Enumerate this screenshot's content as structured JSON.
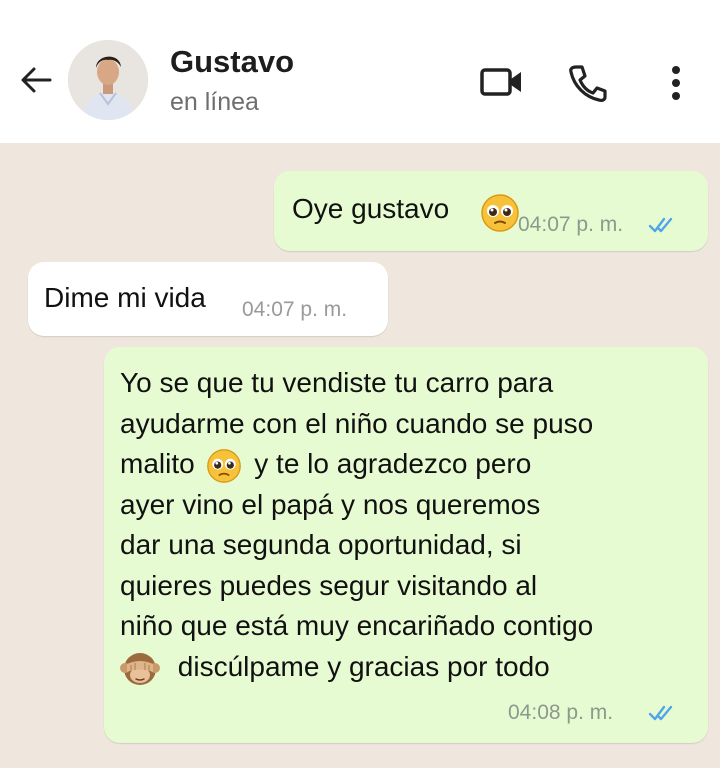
{
  "header": {
    "contact_name": "Gustavo",
    "status": "en línea"
  },
  "icons": {
    "back": "arrow-left-icon",
    "video": "video-call-icon",
    "phone": "phone-icon",
    "menu": "more-vertical-icon",
    "emoji_pleading": "pleading-face-emoji",
    "emoji_monkey": "see-no-evil-monkey-emoji",
    "read": "double-check-icon"
  },
  "colors": {
    "outgoing_bubble": "#e7fbd3",
    "incoming_bubble": "#ffffff",
    "chat_background": "#efe7de",
    "read_ticks": "#4fa6e8"
  },
  "messages": [
    {
      "direction": "out",
      "text": "Oye gustavo",
      "time": "04:07 p. m.",
      "read": true
    },
    {
      "direction": "in",
      "text": "Dime mi vida",
      "time": "04:07 p. m."
    },
    {
      "direction": "out",
      "lines": [
        "Yo se que tu vendiste tu carro para",
        "ayudarme con el niño cuando se puso",
        "malito",
        "y te lo agradezco pero",
        "ayer vino el papá y nos queremos",
        "dar una segunda oportunidad, si",
        "quieres puedes segur visitando al",
        "niño que está muy encariñado contigo",
        "discúlpame y gracias por todo"
      ],
      "time": "04:08 p. m.",
      "read": true
    }
  ]
}
